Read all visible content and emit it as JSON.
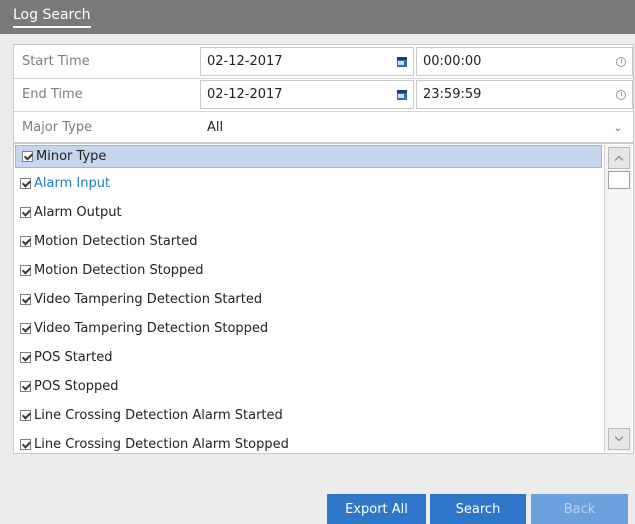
{
  "dialog": {
    "title": "Log Search"
  },
  "form": {
    "start_time": {
      "label": "Start Time",
      "date": "02-12-2017",
      "time": "00:00:00"
    },
    "end_time": {
      "label": "End Time",
      "date": "02-12-2017",
      "time": "23:59:59"
    },
    "major_type": {
      "label": "Major Type",
      "value": "All"
    }
  },
  "minor_type": {
    "header": "Minor Type",
    "items": [
      {
        "label": "Alarm Input",
        "checked": true,
        "highlighted": true
      },
      {
        "label": "Alarm Output",
        "checked": true
      },
      {
        "label": "Motion Detection Started",
        "checked": true
      },
      {
        "label": "Motion Detection Stopped",
        "checked": true
      },
      {
        "label": "Video Tampering Detection Started",
        "checked": true
      },
      {
        "label": "Video Tampering Detection Stopped",
        "checked": true
      },
      {
        "label": "POS Started",
        "checked": true
      },
      {
        "label": "POS Stopped",
        "checked": true
      },
      {
        "label": "Line Crossing Detection Alarm Started",
        "checked": true
      },
      {
        "label": "Line Crossing Detection Alarm Stopped",
        "checked": true
      }
    ]
  },
  "buttons": {
    "export_all": "Export All",
    "search": "Search",
    "back": "Back"
  },
  "colors": {
    "accent": "#2f78c9",
    "highlight_text": "#1b7bd0",
    "header_bg": "#c5d7ee",
    "titlebar_bg": "#7a7a7a"
  }
}
